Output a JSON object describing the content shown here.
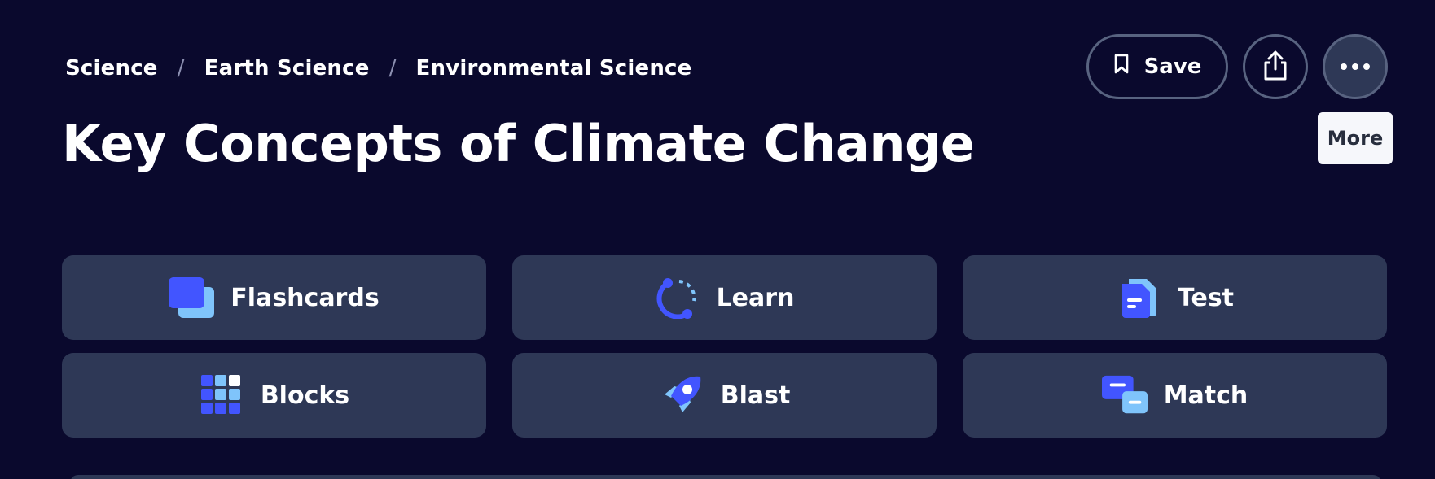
{
  "breadcrumb": {
    "items": [
      {
        "label": "Science"
      },
      {
        "label": "Earth Science"
      },
      {
        "label": "Environmental Science"
      }
    ],
    "separator": "/"
  },
  "page_title": "Key Concepts of Climate Change",
  "header_actions": {
    "save_label": "Save",
    "share_icon": "share-icon",
    "more_icon": "more-dots-icon",
    "tooltip": "More"
  },
  "study_modes": [
    {
      "label": "Flashcards",
      "icon": "flashcards-icon"
    },
    {
      "label": "Learn",
      "icon": "learn-icon"
    },
    {
      "label": "Test",
      "icon": "test-icon"
    },
    {
      "label": "Blocks",
      "icon": "blocks-icon"
    },
    {
      "label": "Blast",
      "icon": "blast-icon"
    },
    {
      "label": "Match",
      "icon": "match-icon"
    }
  ],
  "colors": {
    "background": "#0a092d",
    "card": "#2e3856",
    "accent_blue": "#4255ff",
    "accent_light_blue": "#7fc4fb"
  }
}
